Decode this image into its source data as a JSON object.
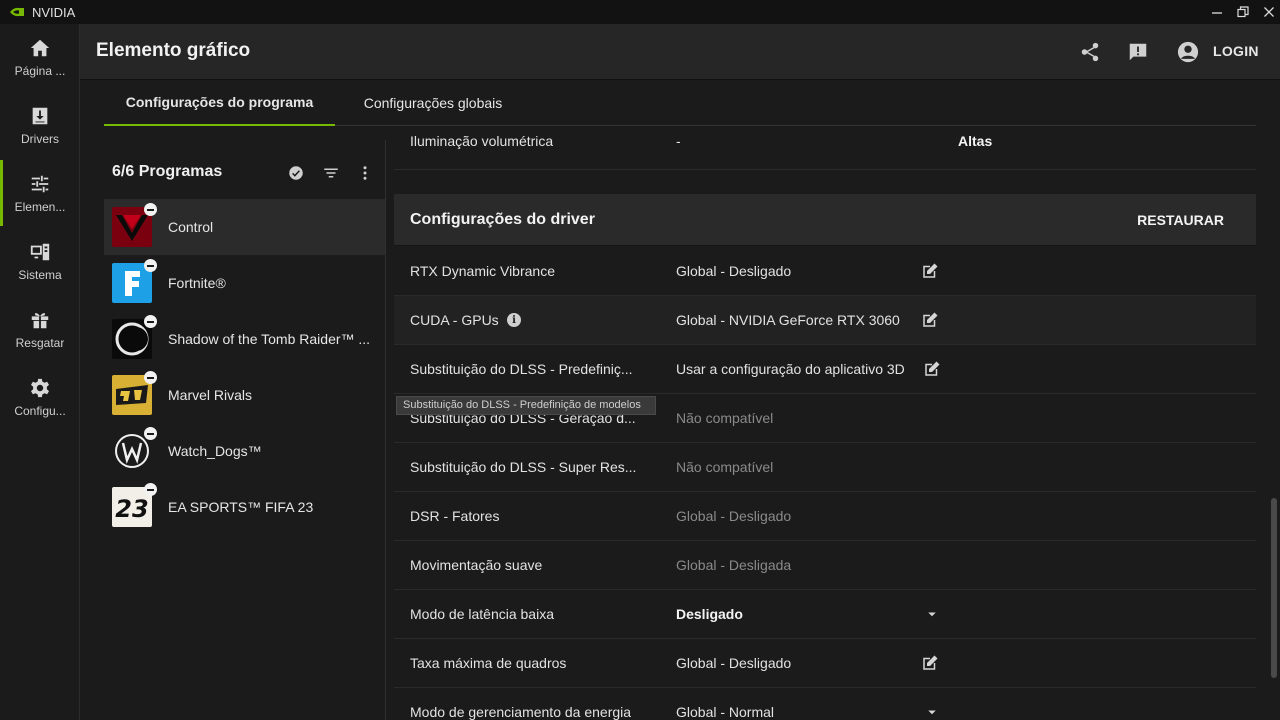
{
  "window": {
    "app_name": "NVIDIA"
  },
  "rail": {
    "items": [
      {
        "label": "Página ...",
        "icon": "home-icon"
      },
      {
        "label": "Drivers",
        "icon": "download-icon"
      },
      {
        "label": "Elemen...",
        "icon": "sliders-icon"
      },
      {
        "label": "Sistema",
        "icon": "system-icon"
      },
      {
        "label": "Resgatar",
        "icon": "gift-icon"
      },
      {
        "label": "Configu...",
        "icon": "gear-icon"
      }
    ]
  },
  "header": {
    "title": "Elemento gráfico",
    "login_label": "LOGIN"
  },
  "tabs": [
    {
      "label": "Configurações do programa"
    },
    {
      "label": "Configurações globais"
    }
  ],
  "programs": {
    "title": "6/6 Programas",
    "items": [
      {
        "name": "Control"
      },
      {
        "name": "Fortnite®"
      },
      {
        "name": "Shadow of the Tomb Raider™ ..."
      },
      {
        "name": "Marvel Rivals"
      },
      {
        "name": "Watch_Dogs™"
      },
      {
        "name": "EA SPORTS™ FIFA 23"
      }
    ]
  },
  "settings": {
    "top_row": {
      "label": "Iluminação volumétrica",
      "value": "-",
      "extra": "Altas"
    },
    "section_title": "Configurações do driver",
    "restore_label": "RESTAURAR",
    "rows": [
      {
        "label": "RTX Dynamic Vibrance",
        "value": "Global - Desligado",
        "control": "edit"
      },
      {
        "label": "CUDA - GPUs",
        "value": "Global - NVIDIA GeForce RTX 3060",
        "control": "edit"
      },
      {
        "label": "Substituição do DLSS - Predefiniç...",
        "value": "Usar a configuração do aplicativo 3D",
        "control": "edit"
      },
      {
        "label": "Substituição do DLSS - Geração d...",
        "value": "Não compatível",
        "control": ""
      },
      {
        "label": "Substituição do DLSS - Super Res...",
        "value": "Não compatível",
        "control": ""
      },
      {
        "label": "DSR - Fatores",
        "value": "Global - Desligado",
        "control": ""
      },
      {
        "label": "Movimentação suave",
        "value": "Global - Desligada",
        "control": ""
      },
      {
        "label": "Modo de latência baixa",
        "value": "Desligado",
        "control": "dropdown"
      },
      {
        "label": "Taxa máxima de quadros",
        "value": "Global - Desligado",
        "control": "edit"
      },
      {
        "label": "Modo de gerenciamento da energia",
        "value": "Global - Normal",
        "control": "dropdown"
      }
    ],
    "tooltip": "Substituição do DLSS - Predefinição de modelos"
  },
  "colors": {
    "accent": "#76b900",
    "background": "#1b1b1b",
    "header": "#262626"
  }
}
